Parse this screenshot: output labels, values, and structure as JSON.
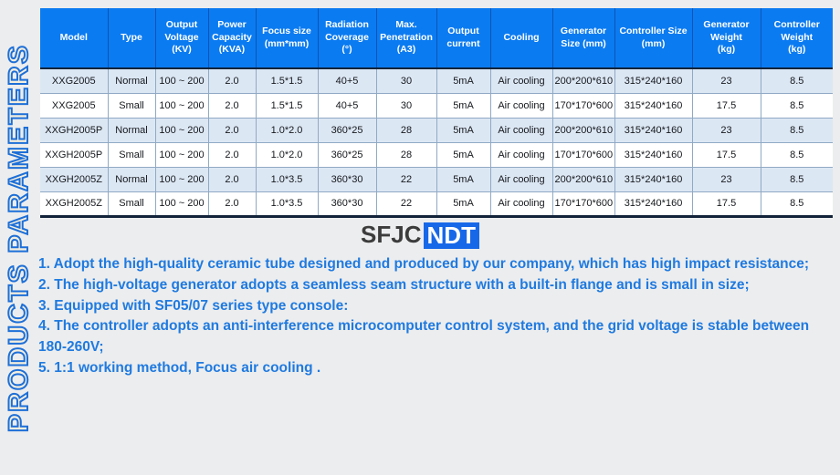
{
  "side_banner": {
    "label": "PRODUCTS PARAMETERS",
    "outline_color": "#1d6fd8",
    "fill_color": "#f4eedd"
  },
  "logo": {
    "text_dark": "SFJC",
    "text_badge": "NDT",
    "badge_color": "#1768e8",
    "dark_color": "#3c3c3c"
  },
  "table": {
    "header_color": "#0b7bf1",
    "stripe_color": "#dce7f4",
    "columns": [
      "Model",
      "Type",
      "Output Voltage (KV)",
      "Power Capacity (KVA)",
      "Focus size (mm*mm)",
      "Radiation Coverage (°)",
      "Max. Penetration (A3)",
      "Output current",
      "Cooling",
      "Generator Size  (mm)",
      "Controller Size (mm)",
      "Generator Weight (kg)",
      "Controller Weight (kg)"
    ],
    "columns_multiline": [
      [
        "Model"
      ],
      [
        "Type"
      ],
      [
        "Output",
        "Voltage",
        "(KV)"
      ],
      [
        "Power",
        "Capacity",
        "(KVA)"
      ],
      [
        "Focus size",
        "(mm*mm)"
      ],
      [
        "Radiation",
        "Coverage",
        "(°)"
      ],
      [
        "Max.",
        "Penetration",
        "(A3)"
      ],
      [
        "Output",
        "current"
      ],
      [
        "Cooling"
      ],
      [
        "Generator",
        "Size  (mm)"
      ],
      [
        "Controller Size",
        "(mm)"
      ],
      [
        "Generator",
        "Weight",
        "(kg)"
      ],
      [
        "Controller",
        "Weight",
        "(kg)"
      ]
    ],
    "rows": [
      {
        "model": "XXG2005",
        "type": "Normal",
        "output_voltage": "100 ~ 200",
        "power_capacity": "2.0",
        "focus_size": "1.5*1.5",
        "radiation_coverage": "40+5",
        "max_penetration": "30",
        "output_current": "5mA",
        "cooling": "Air cooling",
        "generator_size": "200*200*610",
        "controller_size": "315*240*160",
        "generator_weight": "23",
        "controller_weight": "8.5"
      },
      {
        "model": "XXG2005",
        "type": "Small",
        "output_voltage": "100 ~ 200",
        "power_capacity": "2.0",
        "focus_size": "1.5*1.5",
        "radiation_coverage": "40+5",
        "max_penetration": "30",
        "output_current": "5mA",
        "cooling": "Air cooling",
        "generator_size": "170*170*600",
        "controller_size": "315*240*160",
        "generator_weight": "17.5",
        "controller_weight": "8.5"
      },
      {
        "model": "XXGH2005P",
        "type": "Normal",
        "output_voltage": "100 ~ 200",
        "power_capacity": "2.0",
        "focus_size": "1.0*2.0",
        "radiation_coverage": "360*25",
        "max_penetration": "28",
        "output_current": "5mA",
        "cooling": "Air cooling",
        "generator_size": "200*200*610",
        "controller_size": "315*240*160",
        "generator_weight": "23",
        "controller_weight": "8.5"
      },
      {
        "model": "XXGH2005P",
        "type": "Small",
        "output_voltage": "100 ~ 200",
        "power_capacity": "2.0",
        "focus_size": "1.0*2.0",
        "radiation_coverage": "360*25",
        "max_penetration": "28",
        "output_current": "5mA",
        "cooling": "Air cooling",
        "generator_size": "170*170*600",
        "controller_size": "315*240*160",
        "generator_weight": "17.5",
        "controller_weight": "8.5"
      },
      {
        "model": "XXGH2005Z",
        "type": "Normal",
        "output_voltage": "100 ~ 200",
        "power_capacity": "2.0",
        "focus_size": "1.0*3.5",
        "radiation_coverage": "360*30",
        "max_penetration": "22",
        "output_current": "5mA",
        "cooling": "Air cooling",
        "generator_size": "200*200*610",
        "controller_size": "315*240*160",
        "generator_weight": "23",
        "controller_weight": "8.5"
      },
      {
        "model": "XXGH2005Z",
        "type": "Small",
        "output_voltage": "100 ~ 200",
        "power_capacity": "2.0",
        "focus_size": "1.0*3.5",
        "radiation_coverage": "360*30",
        "max_penetration": "22",
        "output_current": "5mA",
        "cooling": "Air cooling",
        "generator_size": "170*170*600",
        "controller_size": "315*240*160",
        "generator_weight": "17.5",
        "controller_weight": "8.5"
      }
    ]
  },
  "notes": {
    "color": "#1f7ae0",
    "items": [
      "1. Adopt the high-quality ceramic tube designed and produced by our company, which has high impact resistance;",
      "2. The high-voltage generator adopts a seamless seam structure with a built-in flange and is small in size;",
      "3. Equipped with SF05/07 series type console:",
      "4. The controller adopts an anti-interference microcomputer control system, and the grid voltage is stable between 180-260V;",
      "5. 1:1 working method, Focus air cooling ."
    ]
  }
}
